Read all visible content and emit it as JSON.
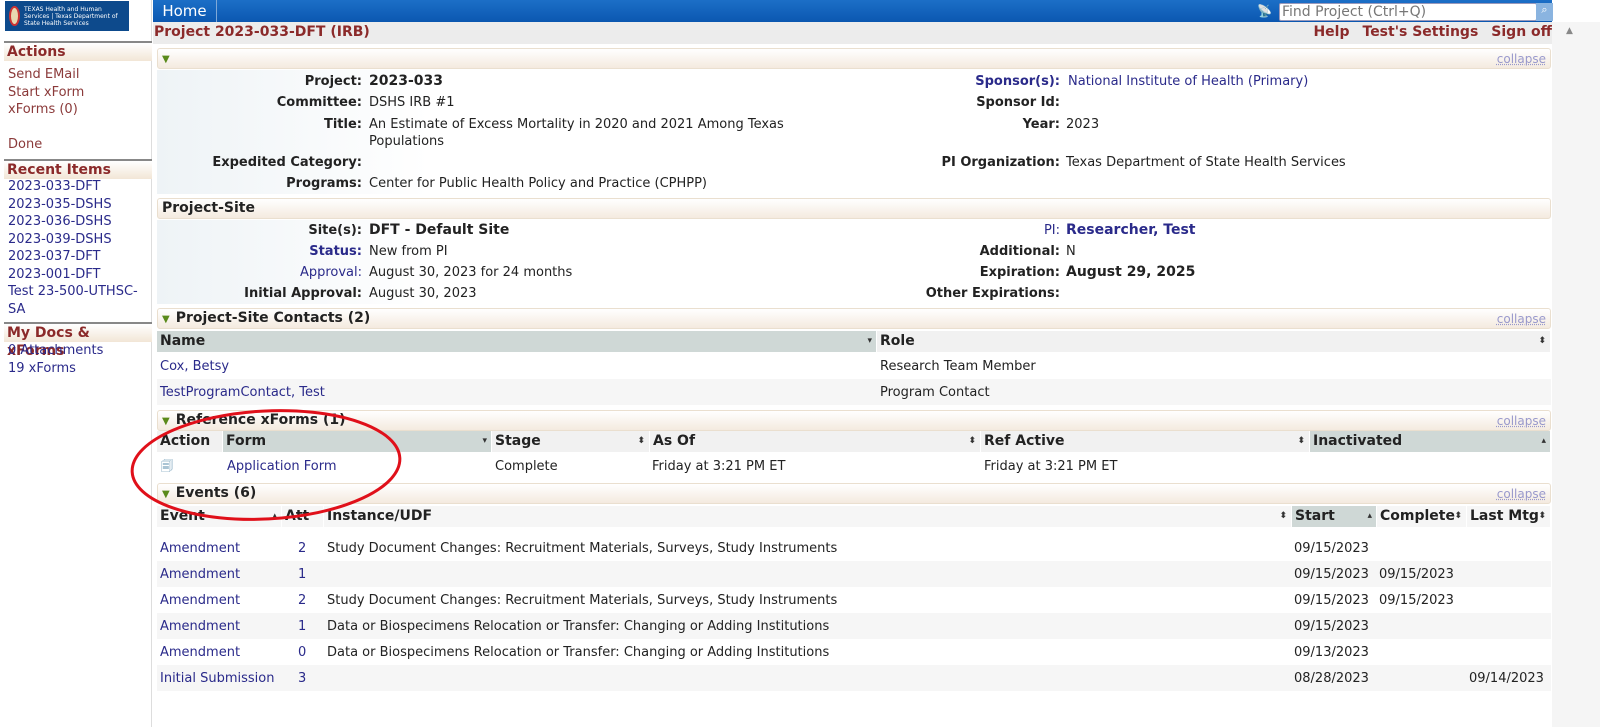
{
  "header": {
    "home": "Home",
    "search_placeholder": "Find Project (Ctrl+Q)",
    "title": "Project 2023-033-DFT (IRB)",
    "links": [
      "Help",
      "Test's Settings",
      "Sign off"
    ]
  },
  "logo": {
    "text": "TEXAS Health and Human Services | Texas Department of State Health Services"
  },
  "sidebar": {
    "actions_title": "Actions",
    "actions": [
      "Send EMail",
      "Start xForm",
      "xForms (0)"
    ],
    "done": "Done",
    "recent_title": "Recent Items",
    "recent": [
      "2023-033-DFT",
      "2023-035-DSHS",
      "2023-036-DSHS",
      "2023-039-DSHS",
      "2023-037-DFT",
      "2023-001-DFT",
      "Test 23-500-UTHSC-SA"
    ],
    "docs_title": "My Docs & xForms",
    "docs": [
      "0 Attachments",
      "19 xForms"
    ]
  },
  "collapse": "collapse",
  "project": {
    "labels": {
      "project": "Project:",
      "committee": "Committee:",
      "title": "Title:",
      "expedited": "Expedited Category:",
      "programs": "Programs:",
      "sponsors": "Sponsor(s):",
      "sponsor_id": "Sponsor Id:",
      "year": "Year:",
      "pi_org": "PI Organization:"
    },
    "project": "2023-033",
    "committee": "DSHS IRB #1",
    "title": "An Estimate of Excess Mortality in 2020 and 2021 Among Texas Populations",
    "expedited": "",
    "programs": "Center for Public Health Policy and Practice (CPHPP)",
    "sponsors": "National Institute of Health (Primary)",
    "sponsor_id": "",
    "year": "2023",
    "pi_org": "Texas Department of State Health Services"
  },
  "site": {
    "title": "Project-Site",
    "labels": {
      "sites": "Site(s):",
      "status": "Status:",
      "approval": "Approval:",
      "initial": "Initial Approval:",
      "pi": "PI:",
      "additional": "Additional:",
      "expiration": "Expiration:",
      "other": "Other Expirations:"
    },
    "sites": "DFT - Default Site",
    "status": "New from PI",
    "approval": "August 30, 2023 for 24 months",
    "initial": "August 30, 2023",
    "pi": "Researcher, Test",
    "additional": "N",
    "expiration": "August 29, 2025",
    "other": ""
  },
  "contacts": {
    "title": "Project-Site Contacts (2)",
    "columns": [
      "Name",
      "Role"
    ],
    "rows": [
      [
        "Cox, Betsy",
        "Research Team Member"
      ],
      [
        "TestProgramContact, Test",
        "Program Contact"
      ]
    ]
  },
  "xforms": {
    "title": "Reference xForms (1)",
    "columns": [
      "Action",
      "Form",
      "Stage",
      "As Of",
      "Ref Active",
      "Inactivated"
    ],
    "rows": [
      {
        "form": "Application Form",
        "stage": "Complete",
        "as_of": "Friday at 3:21 PM ET",
        "ref_active": "Friday at 3:21 PM ET",
        "inactivated": ""
      }
    ]
  },
  "events": {
    "title": "Events (6)",
    "columns": [
      "Event",
      "Att",
      "Instance/UDF",
      "Start",
      "Complete",
      "Last Mtg"
    ],
    "rows": [
      [
        "Amendment",
        "2",
        "Study Document Changes: Recruitment Materials, Surveys, Study Instruments",
        "09/15/2023",
        "",
        ""
      ],
      [
        "Amendment",
        "1",
        "",
        "09/15/2023",
        "09/15/2023",
        ""
      ],
      [
        "Amendment",
        "2",
        "Study Document Changes: Recruitment Materials, Surveys, Study Instruments",
        "09/15/2023",
        "09/15/2023",
        ""
      ],
      [
        "Amendment",
        "1",
        "Data or Biospecimens Relocation or Transfer: Changing or Adding Institutions",
        "09/15/2023",
        "",
        ""
      ],
      [
        "Amendment",
        "0",
        "Data or Biospecimens Relocation or Transfer: Changing or Adding Institutions",
        "09/13/2023",
        "",
        ""
      ],
      [
        "Initial Submission",
        "3",
        "",
        "08/28/2023",
        "",
        "09/14/2023"
      ]
    ]
  },
  "annotation_color": "#e0101a"
}
